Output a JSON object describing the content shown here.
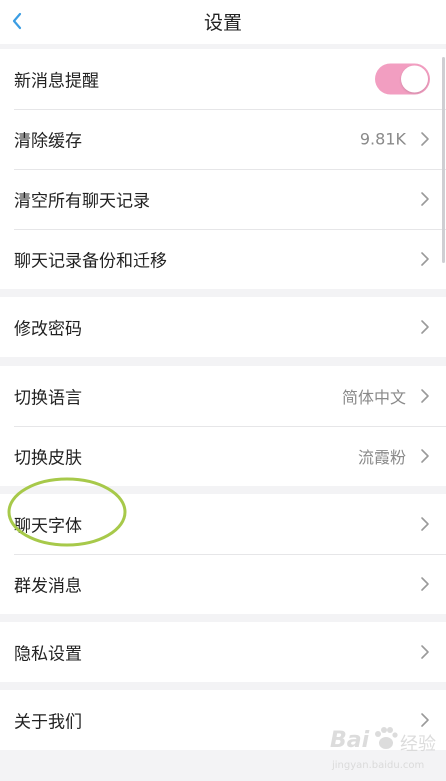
{
  "header": {
    "title": "设置",
    "back_icon": "chevron-left-icon",
    "accent_color": "#3b9de3"
  },
  "groups": [
    {
      "items": [
        {
          "label": "新消息提醒",
          "control": "toggle",
          "toggle_on": true,
          "toggle_color": "#f29ec1"
        },
        {
          "label": "清除缓存",
          "value": "9.81K",
          "control": "chevron"
        },
        {
          "label": "清空所有聊天记录",
          "control": "chevron"
        },
        {
          "label": "聊天记录备份和迁移",
          "control": "chevron"
        }
      ]
    },
    {
      "items": [
        {
          "label": "修改密码",
          "control": "chevron"
        }
      ]
    },
    {
      "items": [
        {
          "label": "切换语言",
          "value": "简体中文",
          "control": "chevron"
        },
        {
          "label": "切换皮肤",
          "value": "流霞粉",
          "control": "chevron"
        }
      ]
    },
    {
      "items": [
        {
          "label": "聊天字体",
          "control": "chevron",
          "highlighted": true
        },
        {
          "label": "群发消息",
          "control": "chevron"
        }
      ]
    },
    {
      "items": [
        {
          "label": "隐私设置",
          "control": "chevron"
        }
      ]
    },
    {
      "items": [
        {
          "label": "关于我们",
          "control": "chevron"
        }
      ]
    }
  ],
  "annotation": {
    "shape": "ellipse",
    "color": "#a7c94a"
  },
  "watermark": {
    "brand": "Bai",
    "brand_suffix": "经验",
    "url": "jingyan.baidu.com"
  }
}
